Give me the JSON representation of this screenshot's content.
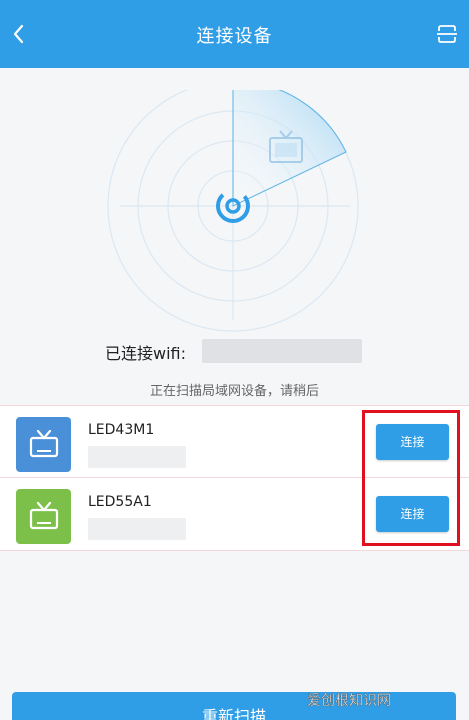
{
  "header": {
    "title": "连接设备",
    "back_icon": "chevron-left-icon",
    "scan_icon": "scan-icon"
  },
  "radar": {
    "center_icon": "logo-icon",
    "found_device_icon": "tv-icon"
  },
  "wifi": {
    "label": "已连接wifi:"
  },
  "scan_status": "正在扫描局域网设备，请稍后",
  "devices": [
    {
      "name": "LED43M1",
      "icon": "tv-icon",
      "icon_color": "#4a90d9",
      "connect_label": "连接"
    },
    {
      "name": "LED55A1",
      "icon": "tv-icon",
      "icon_color": "#7cc04a",
      "connect_label": "连接"
    }
  ],
  "rescan_label": "重新扫描",
  "watermark": "爱创根知识网",
  "colors": {
    "primary": "#2f9ee6",
    "highlight": "#e01020"
  }
}
